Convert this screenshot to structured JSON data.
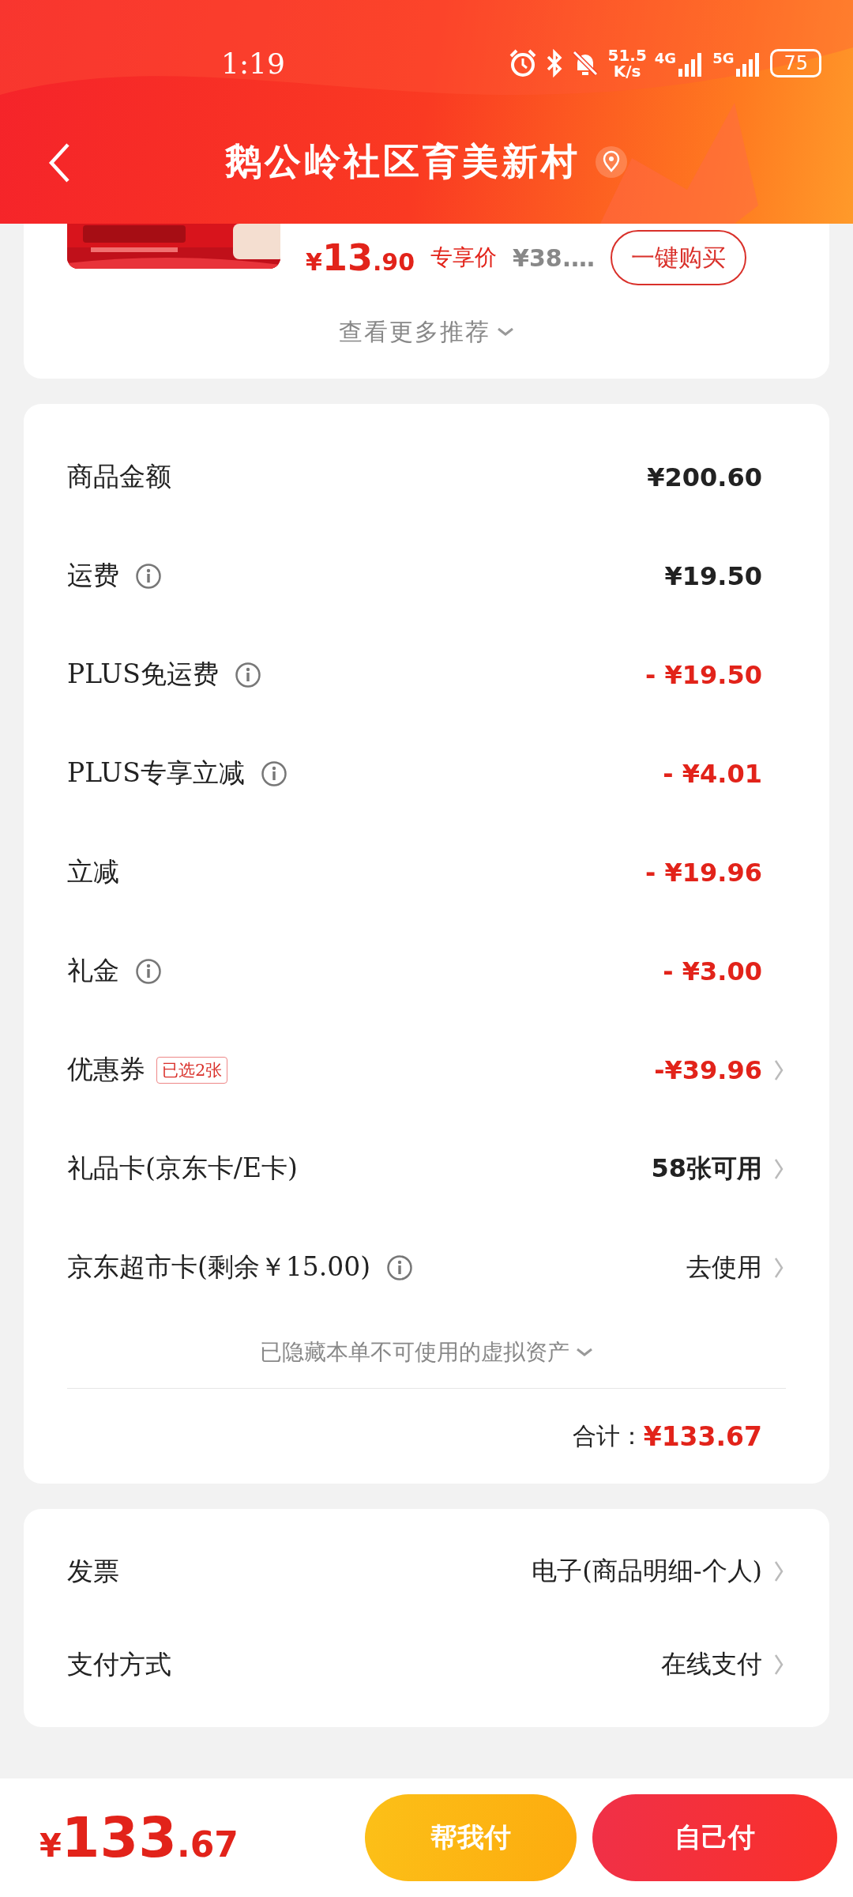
{
  "status_bar": {
    "time": "1:19",
    "speed": "51.5",
    "speed_unit": "K/s",
    "net1": "4G",
    "net2": "5G",
    "battery": "75"
  },
  "header": {
    "title": "鹅公岭社区育美新村"
  },
  "recommend": {
    "currency": "¥",
    "price_int": "13",
    "price_dec": ".90",
    "tag": "专享价",
    "original_price": "¥38.…",
    "buy_button": "一键购买",
    "more": "查看更多推荐"
  },
  "summary": {
    "rows": [
      {
        "label": "商品金额",
        "info": false,
        "value": "¥200.60",
        "kind": "normal",
        "arrow": false
      },
      {
        "label": "运费",
        "info": true,
        "value": "¥19.50",
        "kind": "normal",
        "arrow": false
      },
      {
        "label": "PLUS免运费",
        "info": true,
        "value": "- ¥19.50",
        "kind": "discount",
        "arrow": false
      },
      {
        "label": "PLUS专享立减",
        "info": true,
        "value": "- ¥4.01",
        "kind": "discount",
        "arrow": false
      },
      {
        "label": "立减",
        "info": false,
        "value": "- ¥19.96",
        "kind": "discount",
        "arrow": false
      },
      {
        "label": "礼金",
        "info": true,
        "value": "- ¥3.00",
        "kind": "discount",
        "arrow": false
      },
      {
        "label": "优惠券",
        "badge": "已选2张",
        "info": false,
        "value": "-¥39.96",
        "kind": "discount",
        "arrow": true
      },
      {
        "label": "礼品卡(京东卡/E卡)",
        "info": false,
        "value": "58张可用",
        "kind": "normal",
        "arrow": true
      },
      {
        "label": "京东超市卡(剩余￥15.00)",
        "info": true,
        "value": "去使用",
        "kind": "light",
        "arrow": true
      }
    ],
    "hidden_note": "已隐藏本单不可使用的虚拟资产",
    "total_label": "合计：",
    "total_value": "¥133.67"
  },
  "options": [
    {
      "label": "发票",
      "value": "电子(商品明细-个人)"
    },
    {
      "label": "支付方式",
      "value": "在线支付"
    }
  ],
  "bottom_bar": {
    "currency": "¥",
    "price_int": "133",
    "price_dec": ".67",
    "buttons": [
      {
        "label": "帮我付",
        "kind": "secondary"
      },
      {
        "label": "自己付",
        "kind": "primary"
      }
    ]
  }
}
